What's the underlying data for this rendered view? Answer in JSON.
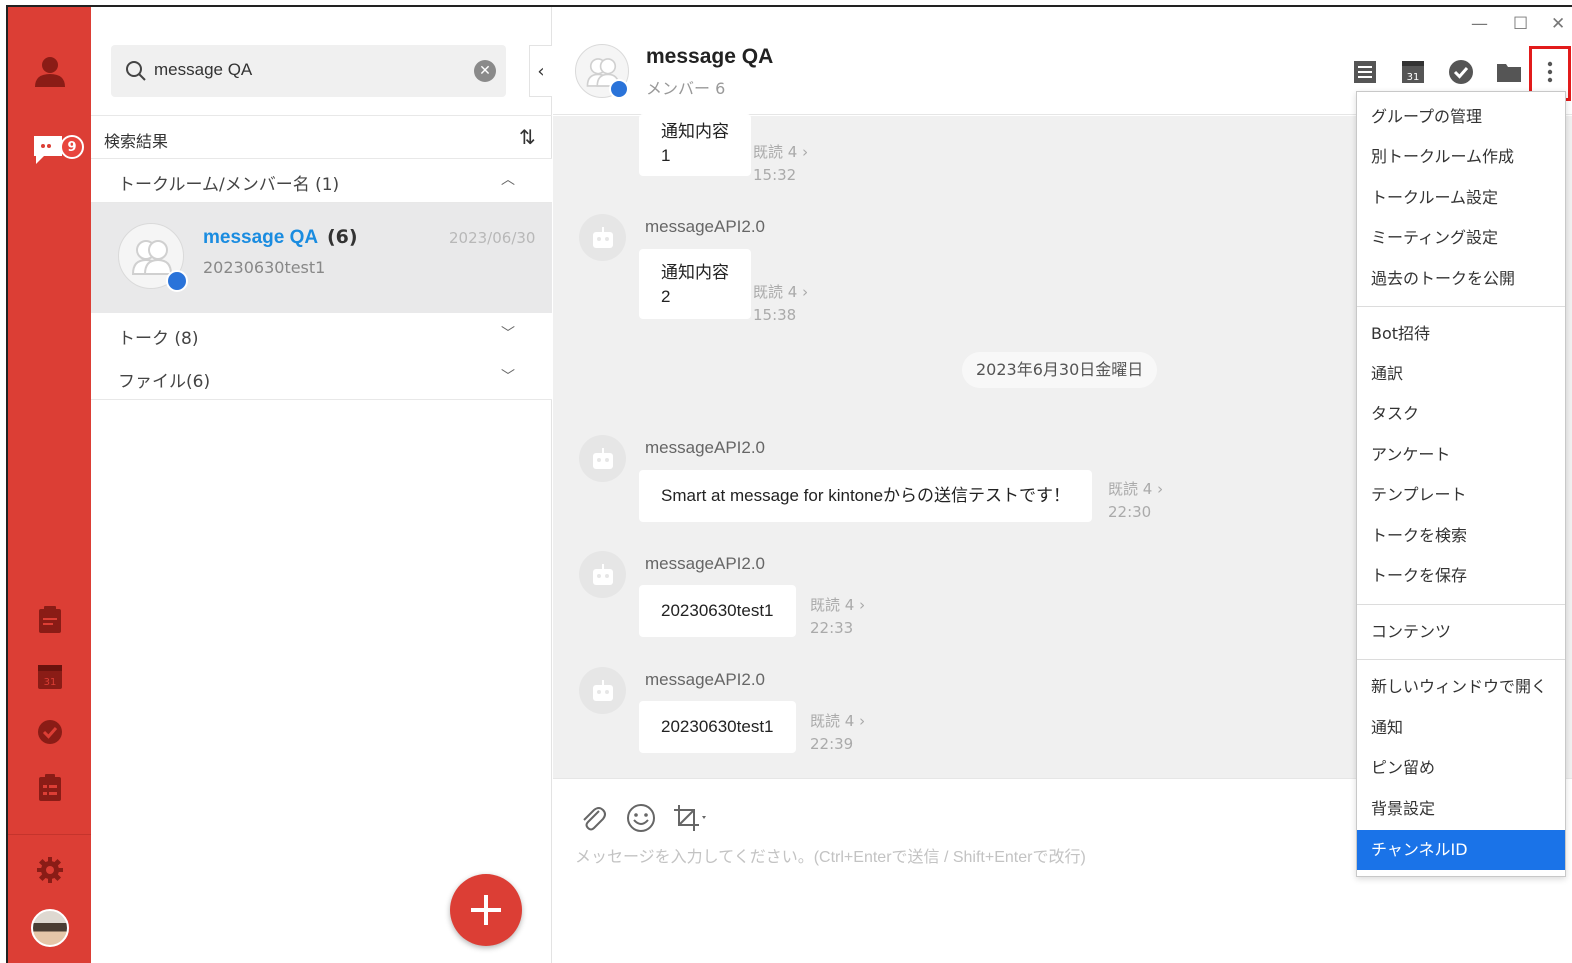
{
  "sidebar": {
    "unread_badge": "9",
    "accent_color": "#dc3e35"
  },
  "search": {
    "query": "message QA"
  },
  "results": {
    "header": "検索結果",
    "sections": {
      "rooms": "トークルーム/メンバー名 (1)",
      "talks": "トーク (8)",
      "files": "ファイル(6)"
    },
    "room": {
      "name": "message QA",
      "count": "(6)",
      "date": "2023/06/30",
      "last_message": "20230630test1"
    }
  },
  "chat": {
    "title": "message QA",
    "members": "メンバー 6",
    "date_separator": "2023年6月30日金曜日",
    "composer_placeholder": "メッセージを入力してください。(Ctrl+Enterで送信 / Shift+Enterで改行)",
    "messages": [
      {
        "sender": "",
        "text_line1": "通知内容",
        "text_line2": "1",
        "read": "既読 4 ›",
        "time": "15:32"
      },
      {
        "sender": "messageAPI2.0",
        "text_line1": "通知内容",
        "text_line2": "2",
        "read": "既読 4 ›",
        "time": "15:38"
      },
      {
        "sender": "messageAPI2.0",
        "text": "Smart at message for kintoneからの送信テストです！",
        "read": "既読 4 ›",
        "time": "22:30"
      },
      {
        "sender": "messageAPI2.0",
        "text": "20230630test1",
        "read": "既読 4 ›",
        "time": "22:33"
      },
      {
        "sender": "messageAPI2.0",
        "text": "20230630test1",
        "read": "既読 4 ›",
        "time": "22:39"
      }
    ]
  },
  "toolbar": {
    "calendar_day": "31"
  },
  "menu": {
    "items": [
      "グループの管理",
      "別トークルーム作成",
      "トークルーム設定",
      "ミーティング設定",
      "過去のトークを公開",
      "Bot招待",
      "通訳",
      "タスク",
      "アンケート",
      "テンプレート",
      "トークを検索",
      "トークを保存",
      "コンテンツ",
      "新しいウィンドウで開く",
      "通知",
      "ピン留め",
      "背景設定",
      "チャンネルID"
    ],
    "highlight_color": "#1a73e8"
  }
}
